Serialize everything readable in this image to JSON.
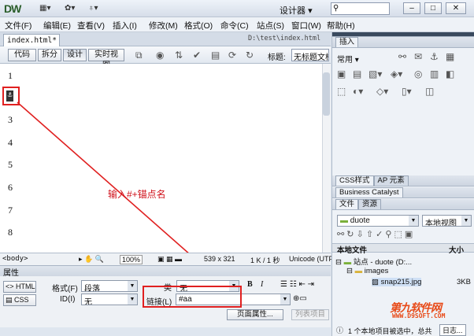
{
  "app": {
    "logo": "DW",
    "workspace": "设计器",
    "workspace_arrow": "▾"
  },
  "menu": [
    "文件(F)",
    "编辑(E)",
    "查看(V)",
    "插入(I)",
    "修改(M)",
    "格式(O)",
    "命令(C)",
    "站点(S)",
    "窗口(W)",
    "帮助(H)"
  ],
  "document": {
    "tab_name": "index.html*",
    "close": "×",
    "path": "D:\\test\\index.html"
  },
  "view_buttons": [
    "代码",
    "拆分",
    "设计",
    "实时视图"
  ],
  "title_field": {
    "label": "标题:",
    "value": "无标题文档"
  },
  "editor": {
    "line_numbers": [
      "1",
      "3",
      "4",
      "5",
      "6",
      "7",
      "8"
    ],
    "anchor_glyph": "⚓",
    "annotation": "输入#+锚点名"
  },
  "status": {
    "tags": "<body>",
    "zoom": "100%",
    "size": "539 x 321",
    "speed": "1 K / 1 秒",
    "encoding": "Unicode (UTF"
  },
  "properties": {
    "header": "属性",
    "html_btn": "HTML",
    "css_btn": "CSS",
    "format_label": "格式(F)",
    "format_value": "段落",
    "class_label": "类",
    "class_value": "无",
    "id_label": "ID(I)",
    "id_value": "无",
    "link_label": "链接(L)",
    "link_value": "#aa",
    "page_props": "页面属性...",
    "list_item": "列表项目"
  },
  "right_panel": {
    "insert_tab": "插入",
    "common": "常用",
    "css_tab": "CSS样式",
    "ap_tab": "AP 元素",
    "bc_tab": "Business Catalyst",
    "files_tab": "文件",
    "assets_tab": "资源",
    "site_select": "duote",
    "view_select": "本地视图",
    "col_local": "本地文件",
    "col_size": "大小",
    "files": [
      {
        "name": "站点 - duote (D:...",
        "size": ""
      },
      {
        "name": "images",
        "size": ""
      },
      {
        "name": "snap215.jpg",
        "size": "3KB"
      }
    ],
    "status": "1 个本地项目被选中，总共",
    "log_btn": "日志..."
  },
  "watermark": {
    "text": "第九软件网",
    "url": "WWW.D9SOFT.COM"
  },
  "colors": {
    "accent_red": "#e02020",
    "logo_green": "#2a5d2a"
  }
}
